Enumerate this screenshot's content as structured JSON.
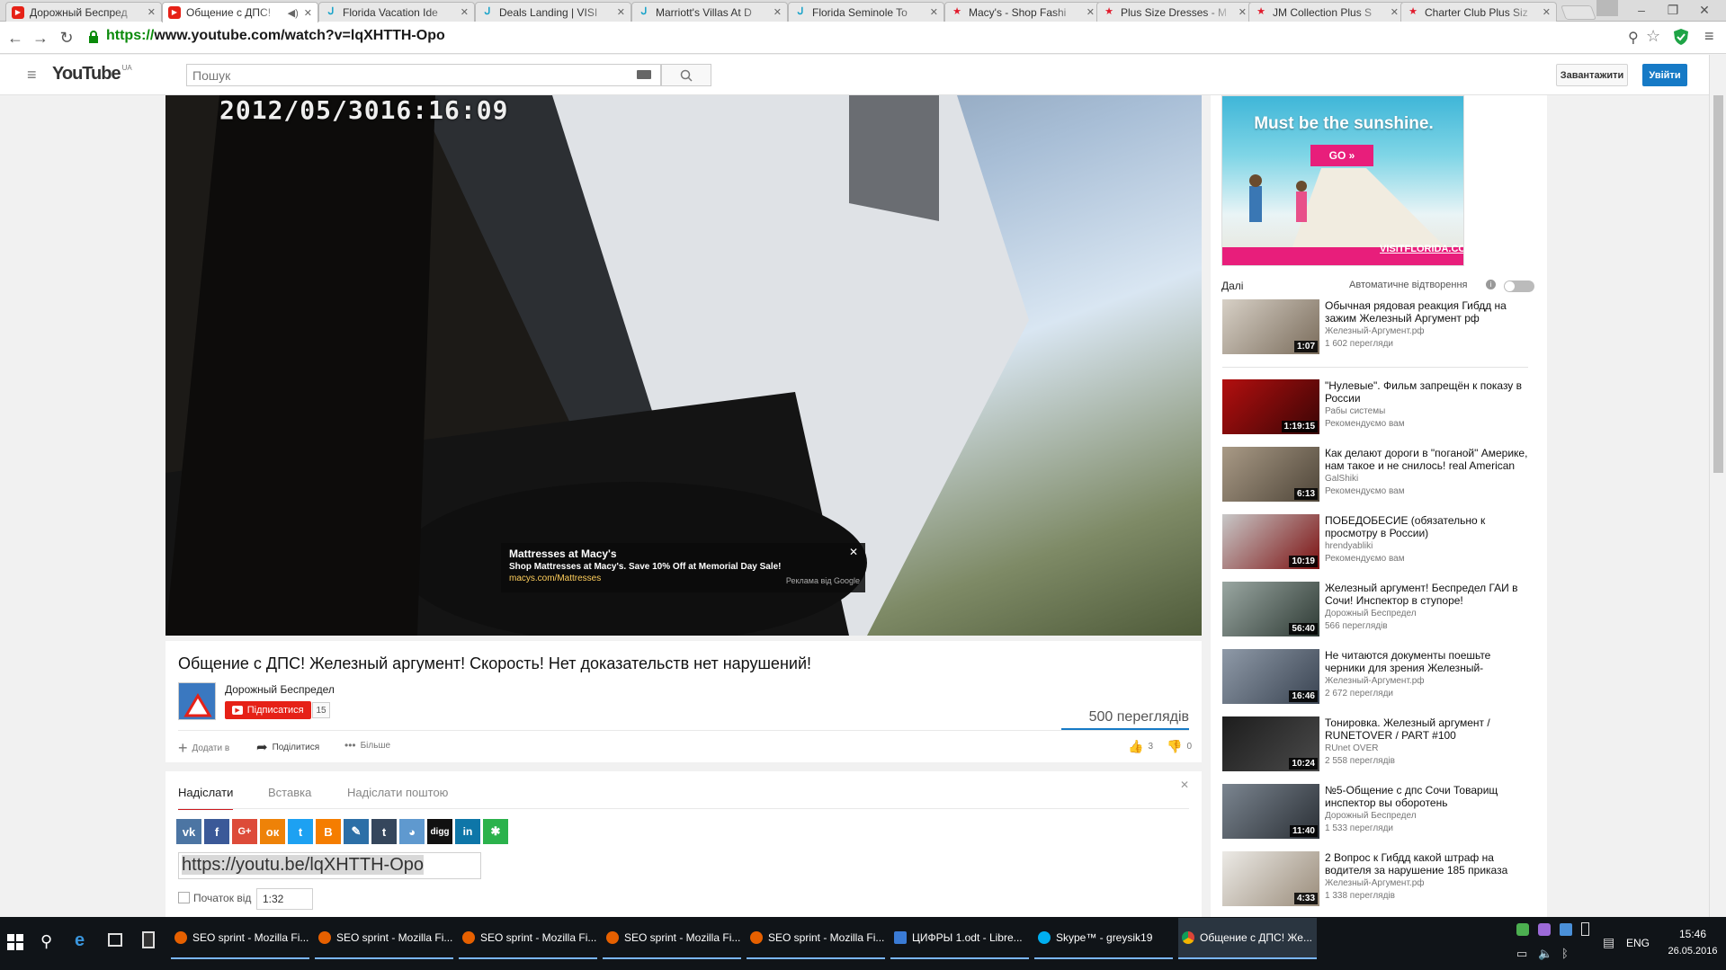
{
  "browser": {
    "tabs": [
      {
        "title": "Дорожный Беспред",
        "icon": "youtube-icon",
        "active": false
      },
      {
        "title": "Общение с ДПС!",
        "icon": "youtube-icon",
        "active": true
      },
      {
        "title": "Florida Vacation Ide",
        "icon": "visitflorida-icon",
        "active": false
      },
      {
        "title": "Deals Landing | VISI",
        "icon": "visitflorida-icon",
        "active": false
      },
      {
        "title": "Marriott's Villas At D",
        "icon": "visitflorida-icon",
        "active": false
      },
      {
        "title": "Florida Seminole To",
        "icon": "visitflorida-icon",
        "active": false
      },
      {
        "title": "Macy's - Shop Fashi",
        "icon": "macys-star-icon",
        "active": false
      },
      {
        "title": "Plus Size Dresses - M",
        "icon": "macys-star-icon",
        "active": false
      },
      {
        "title": "JM Collection Plus S",
        "icon": "macys-star-icon",
        "active": false
      },
      {
        "title": "Charter Club Plus Siz",
        "icon": "macys-star-icon",
        "active": false
      }
    ],
    "url_scheme": "https://",
    "url_rest": "www.youtube.com/watch?v=lqXHTTH-Opo"
  },
  "yt": {
    "logo_text": "YouTube",
    "region": "UA",
    "search_placeholder": "Пошук",
    "upload_label": "Завантажити",
    "signin_label": "Увійти"
  },
  "player": {
    "timestamp": "2012/05/3016:16:09",
    "ad": {
      "title": "Mattresses at Macy's",
      "text": "Shop Mattresses at Macy's. Save 10% Off at Memorial Day Sale!",
      "url": "macys.com/Mattresses",
      "source": "Реклама від Google"
    }
  },
  "video": {
    "title": "Общение с ДПС! Железный аргумент! Скорость! Нет доказательств нет нарушений!",
    "channel": "Дорожный Беспредел",
    "subscribe_label": "Підписатися",
    "subscribers": "15",
    "views": "500 переглядів",
    "add_label": "Додати в",
    "share_label": "Поділитися",
    "more_label": "Більше",
    "likes": "3",
    "dislikes": "0"
  },
  "share": {
    "tabs": [
      "Надіслати",
      "Вставка",
      "Надіслати поштою"
    ],
    "icons": [
      "vk",
      "facebook",
      "google-plus",
      "odnoklassniki",
      "twitter",
      "blogger",
      "livejournal",
      "tumblr",
      "reddit",
      "digg",
      "linkedin",
      "mail-ru"
    ],
    "short_url": "https://youtu.be/lqXHTTH-Opo",
    "start_label": "Початок від",
    "start_time": "1:32"
  },
  "sidebar": {
    "banner": {
      "headline": "Must be the sunshine.",
      "cta": "GO »",
      "brand": "VISITFLORIDA.COM"
    },
    "next_label": "Далі",
    "autoplay_label": "Автоматичне відтворення",
    "recs": [
      {
        "title": "Обычная рядовая реакция Гибдд на зажим Железный Аргумент рф",
        "channel": "Железный-Аргумент.рф",
        "views": "1 602 перегляди",
        "duration": "1:07"
      },
      {
        "title": "\"Нулевые\". Фильм запрещён к показу в России",
        "channel": "Рабы системы",
        "views": "Рекомендуємо вам",
        "duration": "1:19:15"
      },
      {
        "title": "Как делают дороги в \"поганой\" Америке, нам такое и не снилось! real American",
        "channel": "GalShiki",
        "views": "Рекомендуємо вам",
        "duration": "6:13"
      },
      {
        "title": "ПОБЕДОБЕСИЕ (обязательно к просмотру в России)",
        "channel": "hrendyabliki",
        "views": "Рекомендуємо вам",
        "duration": "10:19"
      },
      {
        "title": "Железный аргумент! Беспредел ГАИ в Сочи! Инспектор в ступоре!",
        "channel": "Дорожный Беспредел",
        "views": "566 переглядів",
        "duration": "56:40"
      },
      {
        "title": "Не читаются документы поешьте черники для зрения Железный-",
        "channel": "Железный-Аргумент.рф",
        "views": "2 672 перегляди",
        "duration": "16:46"
      },
      {
        "title": "Тонировка. Железный аргумент / RUNETOVER / PART #100",
        "channel": "RUnet OVER",
        "views": "2 558 переглядів",
        "duration": "10:24"
      },
      {
        "title": "№5-Общение с дпс Сочи Товарищ инспектор вы оборотень",
        "channel": "Дорожный Беспредел",
        "views": "1 533 перегляди",
        "duration": "11:40"
      },
      {
        "title": "2 Вопрос к Гибдд какой штраф на водителя за нарушение 185 приказа",
        "channel": "Железный-Аргумент.рф",
        "views": "1 338 переглядів",
        "duration": "4:33"
      }
    ]
  },
  "taskbar": {
    "items": [
      {
        "label": "SEO sprint - Mozilla Fi...",
        "color": "#e66000"
      },
      {
        "label": "SEO sprint - Mozilla Fi...",
        "color": "#e66000"
      },
      {
        "label": "SEO sprint - Mozilla Fi...",
        "color": "#e66000"
      },
      {
        "label": "SEO sprint - Mozilla Fi...",
        "color": "#e66000"
      },
      {
        "label": "SEO sprint - Mozilla Fi...",
        "color": "#e66000"
      },
      {
        "label": "ЦИФРЫ 1.odt - Libre...",
        "color": "#3a7bd5"
      },
      {
        "label": "Skype™ - greysik19",
        "color": "#00aff0"
      },
      {
        "label": "Общение с ДПС! Же...",
        "color": "#4caf50"
      }
    ],
    "lang": "ENG",
    "time": "15:46",
    "date": "26.05.2016"
  }
}
